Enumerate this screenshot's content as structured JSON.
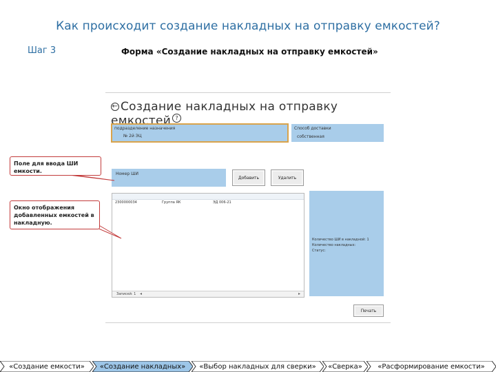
{
  "slide": {
    "title": "Как происходит создание накладных на отправку емкостей?",
    "step": "Шаг 3",
    "heading": "Форма «Создание накладных на отправку емкостей»"
  },
  "form": {
    "title": "Создание накладных на отправку емкостей",
    "back_icon": "back-arrow-icon",
    "help_icon": "help-icon",
    "left_panel": {
      "label": "подразделение назначения",
      "value": "№ 2й ЭЦ"
    },
    "right_panel": {
      "label": "Способ доставки",
      "value": "собственная"
    },
    "input": {
      "label": "Номер ШИ"
    },
    "buttons": {
      "add": "Добавить",
      "delete": "Удалить",
      "print": "Печать"
    },
    "list": {
      "rows": [
        {
          "c1": "2300000034",
          "c2": "Группа ЯК",
          "c3": "ЭД 006-21"
        }
      ],
      "footer": "Записей: 1"
    },
    "info_panel": [
      "Количество ШИ в накладной: 1",
      "Количество накладных:",
      "Статус:"
    ]
  },
  "callouts": {
    "input_hint": "Поле для ввода ШИ емкости.",
    "list_hint": "Окно отображения добавленных емкостей в накладную."
  },
  "nav": [
    {
      "label": "«Создание емкости»",
      "active": false
    },
    {
      "label": "«Создание накладных»",
      "active": true
    },
    {
      "label": "«Выбор накладных для сверки»",
      "active": false
    },
    {
      "label": "«Сверка»",
      "active": false
    },
    {
      "label": "«Расформирование емкости»",
      "active": false
    }
  ],
  "colors": {
    "title": "#2e6fa3",
    "panel_blue": "#a9cdea",
    "frame_orange": "#d9a34a",
    "callout_border": "#c23a3a",
    "nav_active": "#9dc6e8",
    "nav_inactive": "#ffffff"
  }
}
